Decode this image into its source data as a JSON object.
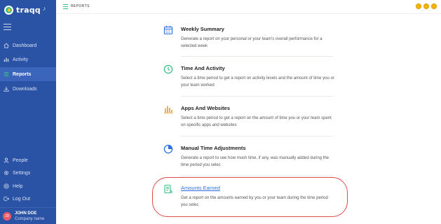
{
  "brand": {
    "name": "traqq"
  },
  "header": {
    "title": "REPORTS"
  },
  "sidebar": {
    "items": [
      {
        "label": "Dashboard",
        "icon": "home-icon"
      },
      {
        "label": "Activity",
        "icon": "bar-chart-icon"
      },
      {
        "label": "Reports",
        "icon": "list-icon"
      },
      {
        "label": "Downloads",
        "icon": "download-icon"
      }
    ],
    "bottom_items": [
      {
        "label": "People",
        "icon": "person-icon"
      },
      {
        "label": "Settings",
        "icon": "gear-icon"
      },
      {
        "label": "Help",
        "icon": "help-icon"
      },
      {
        "label": "Log Out",
        "icon": "logout-icon"
      }
    ],
    "user": {
      "initials": "JD",
      "name": "JOHN DOE",
      "company": "Company name"
    }
  },
  "reports": [
    {
      "title": "Weekly Summary",
      "description": "Generate a report on your personal or your team's overall performance for a selected week",
      "icon": "calendar-icon"
    },
    {
      "title": "Time And Activity",
      "description": "Select a time period to get a report on activity levels and the amount of time you or your team worked",
      "icon": "clock-icon"
    },
    {
      "title": "Apps And Websites",
      "description": "Select a time period to get a report on the amount of time you or your team spent on specific apps and websites",
      "icon": "bar-chart-icon"
    },
    {
      "title": "Manual Time Adjustments",
      "description": "Generate a report to see how much time, if any, was manually added during the time period you selec",
      "icon": "pie-chart-icon"
    },
    {
      "title": "Amounts Earned",
      "description": "Get a report on the amounts earned by you or your team during the time period you selec",
      "icon": "invoice-icon"
    }
  ],
  "colors": {
    "sidebar": "#2a53a6",
    "accent": "#3bbf88",
    "link": "#2f6fe0",
    "highlight": "#e04a4a",
    "status_dot": "#f4b400"
  }
}
